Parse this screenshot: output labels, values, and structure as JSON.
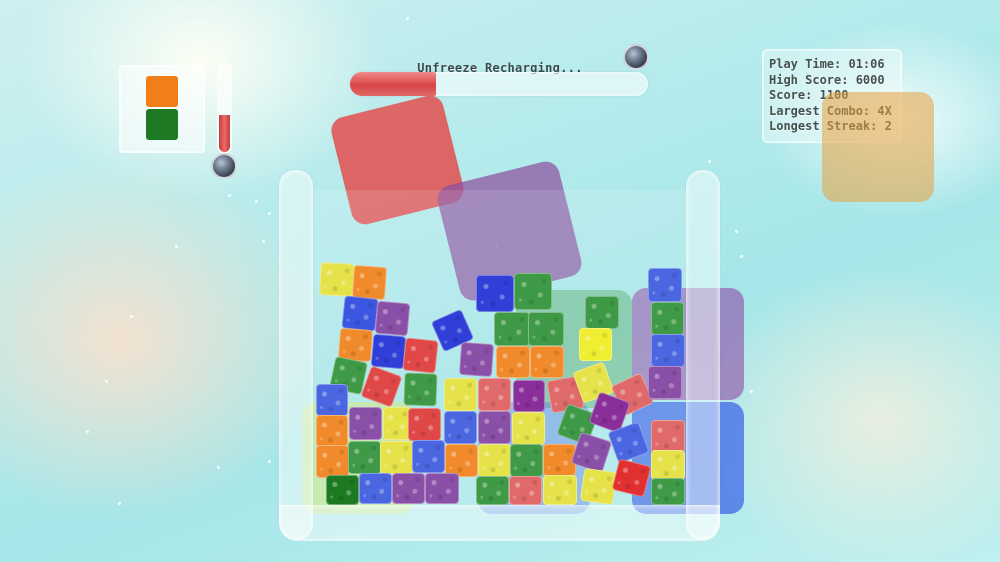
{
  "hud": {
    "status_label": "Unfreeze Recharging...",
    "recharge_progress": 0.29
  },
  "stats": {
    "play_time": "Play Time: 01:06",
    "high_score": "High Score: 6000",
    "score": "Score: 1100",
    "largest_combo": "Largest Combo: 4X",
    "longest_streak": "Longest Streak: 2"
  },
  "next_piece": {
    "colors": [
      "#f07f1a",
      "#1d7a22"
    ]
  },
  "pressure_gauge": {
    "level": 0.42
  },
  "colors": {
    "red": "#e04848",
    "orange": "#f08a2a",
    "yellow": "#e6e24a",
    "green": "#3f9a48",
    "blue": "#3b56e0",
    "purple": "#8a4fa6",
    "accent_bar": "#d94444"
  }
}
